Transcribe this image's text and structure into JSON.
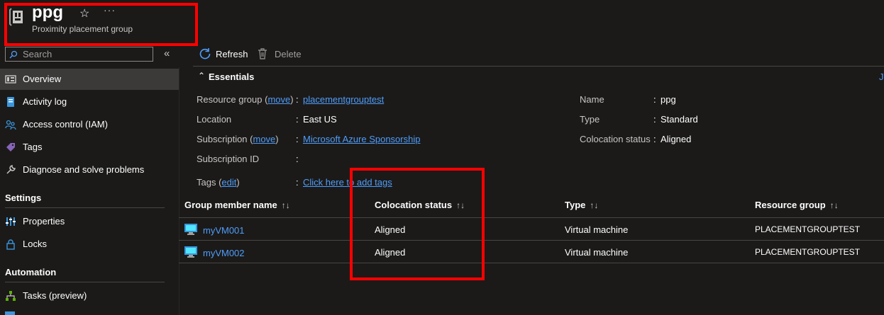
{
  "header": {
    "title": "ppg",
    "subtitle": "Proximity placement group",
    "more": "···"
  },
  "sidebar": {
    "search_placeholder": "Search",
    "collapse": "«",
    "items": [
      {
        "label": "Overview",
        "icon": "overview-icon",
        "active": true
      },
      {
        "label": "Activity log",
        "icon": "activity-log-icon"
      },
      {
        "label": "Access control (IAM)",
        "icon": "iam-icon"
      },
      {
        "label": "Tags",
        "icon": "tag-icon"
      },
      {
        "label": "Diagnose and solve problems",
        "icon": "wrench-icon"
      }
    ],
    "settings_heading": "Settings",
    "settings_items": [
      {
        "label": "Properties",
        "icon": "properties-icon"
      },
      {
        "label": "Locks",
        "icon": "lock-icon"
      }
    ],
    "automation_heading": "Automation",
    "automation_items": [
      {
        "label": "Tasks (preview)",
        "icon": "tasks-icon"
      }
    ]
  },
  "toolbar": {
    "refresh_label": "Refresh",
    "delete_label": "Delete"
  },
  "essentials": {
    "title": "Essentials",
    "right_link": "J",
    "left": [
      {
        "label": "Resource group",
        "paren_link": "move",
        "value": "placementgrouptest",
        "value_is_link": true
      },
      {
        "label": "Location",
        "value": "East US"
      },
      {
        "label": "Subscription",
        "paren_link": "move",
        "value": "Microsoft Azure Sponsorship",
        "value_is_link": true
      },
      {
        "label": "Subscription ID",
        "value": ""
      },
      {
        "label": "Tags",
        "paren_link": "edit",
        "value": "Click here to add tags",
        "value_is_link": true
      }
    ],
    "right": [
      {
        "label": "Name",
        "value": "ppg"
      },
      {
        "label": "Type",
        "value": "Standard"
      },
      {
        "label": "Colocation status",
        "value": "Aligned"
      }
    ]
  },
  "table": {
    "columns": [
      "Group member name",
      "Colocation status",
      "Type",
      "Resource group"
    ],
    "sort_glyph": "↑↓",
    "rows": [
      [
        "myVM001",
        "Aligned",
        "Virtual machine",
        "PLACEMENTGROUPTEST"
      ],
      [
        "myVM002",
        "Aligned",
        "Virtual machine",
        "PLACEMENTGROUPTEST"
      ]
    ]
  },
  "colors": {
    "background": "#1b1a19",
    "active_nav": "#3b3a39",
    "link": "#4f9df9",
    "highlight_box": "#ff0000"
  }
}
